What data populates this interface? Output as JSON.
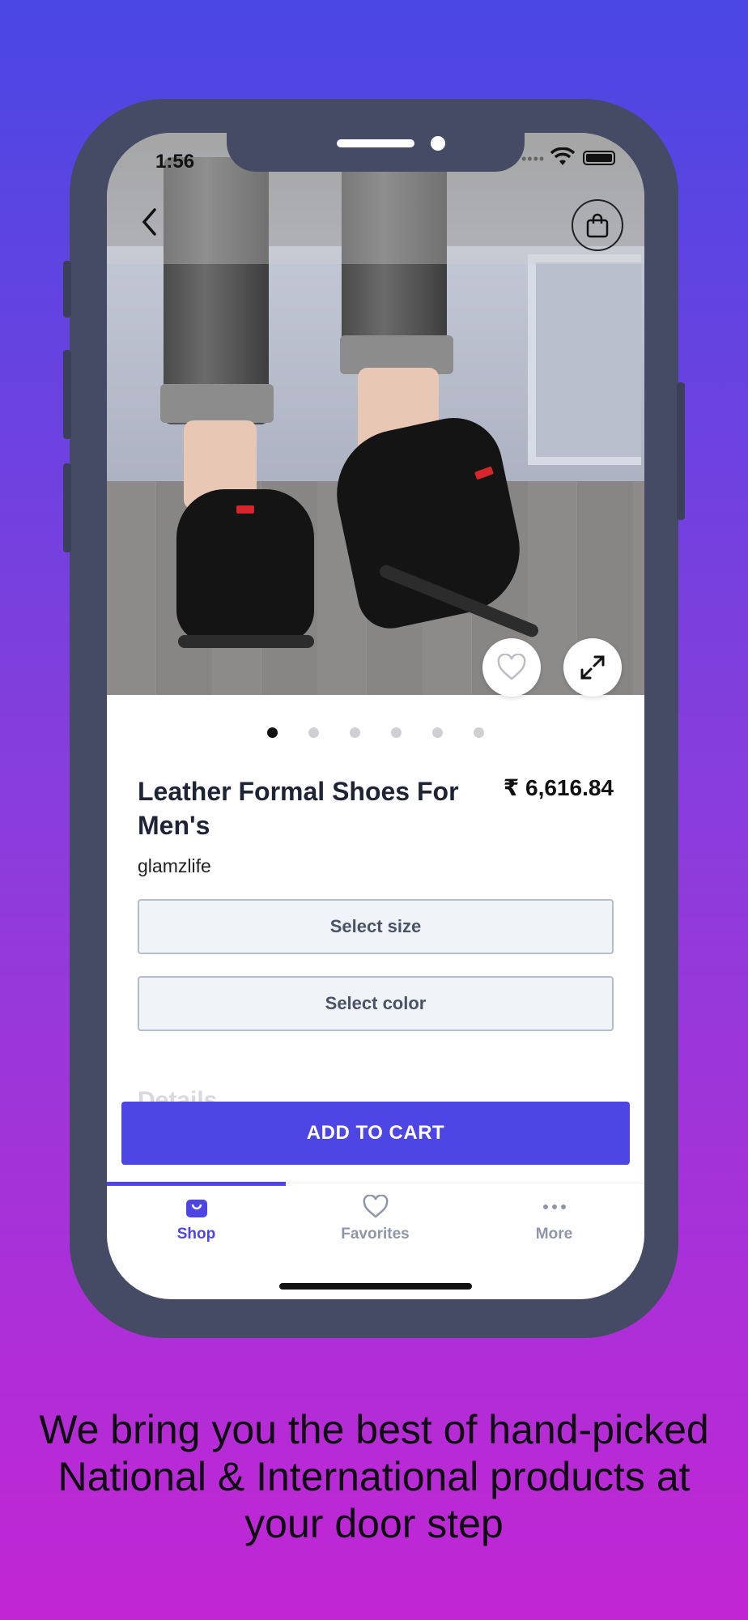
{
  "status_bar": {
    "time": "1:56"
  },
  "product": {
    "title": "Leather Formal Shoes For Men's",
    "price": "₹ 6,616.84",
    "brand": "glamzlife",
    "image_count": 6,
    "active_image_index": 0
  },
  "options": {
    "size_label": "Select size",
    "color_label": "Select color"
  },
  "details_peek": "Details",
  "cart": {
    "label": "ADD TO CART"
  },
  "tabs": [
    {
      "label": "Shop",
      "icon": "shopping-bag-icon",
      "active": true
    },
    {
      "label": "Favorites",
      "icon": "heart-icon",
      "active": false
    },
    {
      "label": "More",
      "icon": "more-dots-icon",
      "active": false
    }
  ],
  "tagline": "We bring you the best of hand-picked National & International products at your door step",
  "colors": {
    "accent": "#4d45e4",
    "background_top": "#4a47e4",
    "background_bottom": "#c226d4",
    "phone_frame": "#454b64"
  }
}
